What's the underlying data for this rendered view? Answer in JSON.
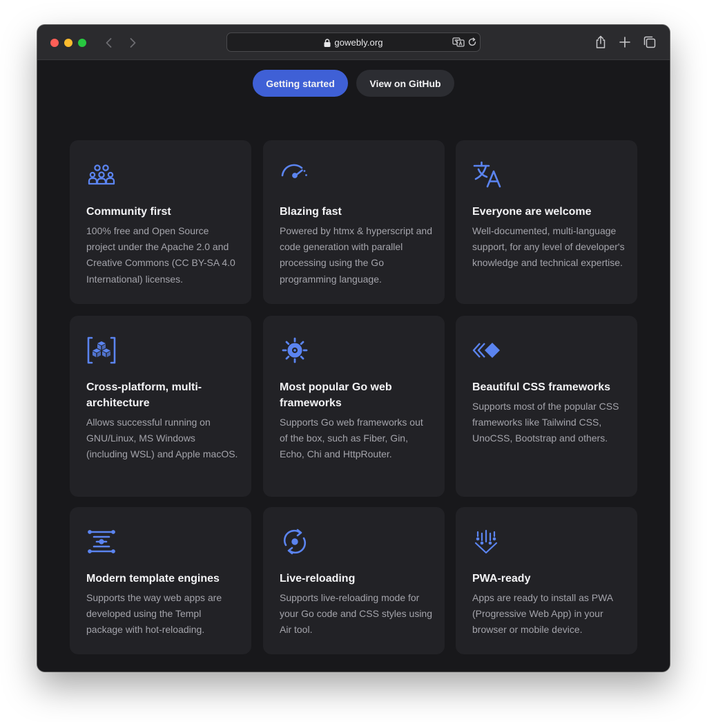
{
  "browser": {
    "url": "gowebly.org"
  },
  "hero": {
    "primary_label": "Getting started",
    "secondary_label": "View on GitHub"
  },
  "accent_color": "#5b84f0",
  "features": [
    {
      "icon": "community-icon",
      "title": "Community first",
      "description": "100% free and Open Source project under the Apache 2.0 and Creative Commons (CC BY-SA 4.0 International) licenses."
    },
    {
      "icon": "speedometer-icon",
      "title": "Blazing fast",
      "description": "Powered by htmx & hyperscript and code generation with parallel processing using the Go programming language."
    },
    {
      "icon": "translate-icon",
      "title": "Everyone are welcome",
      "description": "Well-documented, multi-language support, for any level of developer's knowledge and technical expertise."
    },
    {
      "icon": "cubes-icon",
      "title": "Cross-platform, multi-architecture",
      "description": "Allows successful running on GNU/Linux, MS Windows (including WSL) and Apple macOS."
    },
    {
      "icon": "gear-icon",
      "title": "Most popular Go web frameworks",
      "description": "Supports Go web frameworks out of the box, such as Fiber, Gin, Echo, Chi and HttpRouter."
    },
    {
      "icon": "diamonds-icon",
      "title": "Beautiful CSS frameworks",
      "description": "Supports most of the popular CSS frameworks like Tailwind CSS, UnoCSS, Bootstrap and others."
    },
    {
      "icon": "template-icon",
      "title": "Modern template engines",
      "description": "Supports the way web apps are developed using the Templ package with hot-reloading."
    },
    {
      "icon": "reload-icon",
      "title": "Live-reloading",
      "description": "Supports live-reloading mode for your Go code and CSS styles using Air tool."
    },
    {
      "icon": "download-icon",
      "title": "PWA-ready",
      "description": "Apps are ready to install as PWA (Progressive Web App) in your browser or mobile device."
    }
  ]
}
